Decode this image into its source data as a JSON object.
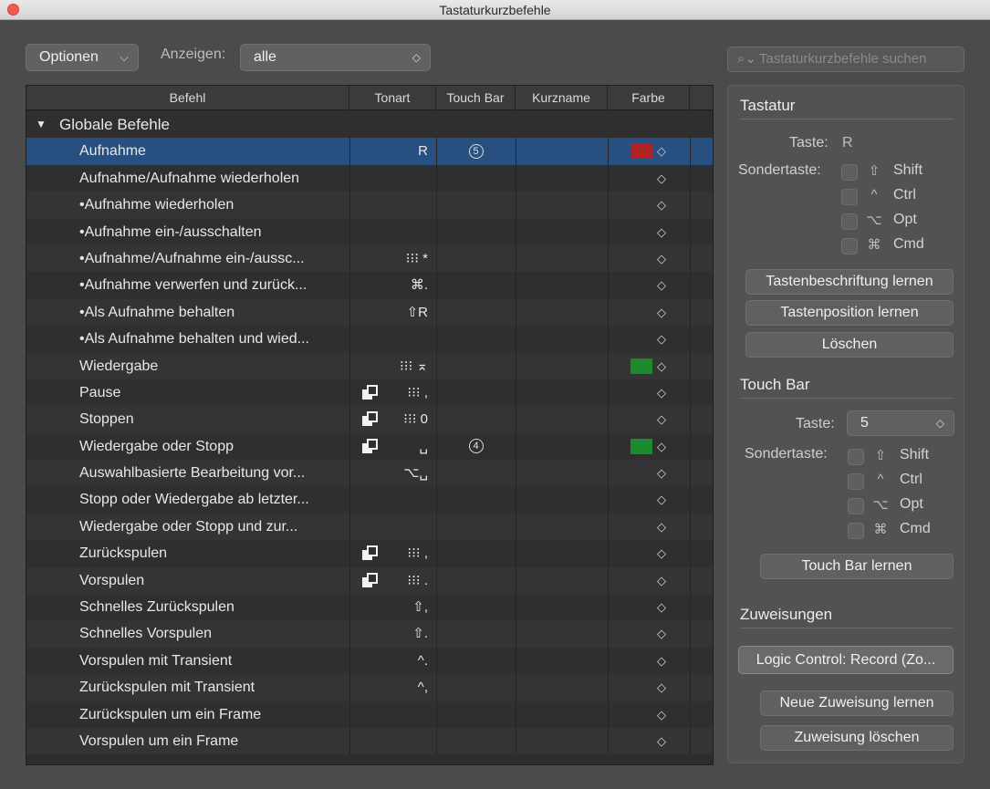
{
  "window": {
    "title": "Tastaturkurzbefehle"
  },
  "toolbar": {
    "options_label": "Optionen",
    "show_label": "Anzeigen:",
    "show_value": "alle",
    "search_placeholder": "Tastaturkurzbefehle suchen"
  },
  "table": {
    "columns": [
      "Befehl",
      "Tonart",
      "Touch Bar",
      "Kurzname",
      "Farbe"
    ],
    "group": "Globale Befehle",
    "rows": [
      {
        "name": "Aufnahme",
        "key": "R",
        "touchbar": "5",
        "color": "#b22222",
        "selected": true,
        "dup": false
      },
      {
        "name": "Aufnahme/Aufnahme wiederholen",
        "key": "",
        "touchbar": "",
        "color": "",
        "dup": false
      },
      {
        "name": "•Aufnahme wiederholen",
        "key": "",
        "touchbar": "",
        "color": "",
        "dup": false
      },
      {
        "name": "•Aufnahme ein-/ausschalten",
        "key": "",
        "touchbar": "",
        "color": "",
        "dup": false
      },
      {
        "name": "•Aufnahme/Aufnahme ein-/aussc...",
        "key": "⁝⁝⁝ *",
        "touchbar": "",
        "color": "",
        "dup": false
      },
      {
        "name": "•Aufnahme verwerfen und zurück...",
        "key": "⌘.",
        "touchbar": "",
        "color": "",
        "dup": false
      },
      {
        "name": "•Als Aufnahme behalten",
        "key": "⇧R",
        "touchbar": "",
        "color": "",
        "dup": false
      },
      {
        "name": "•Als Aufnahme behalten und wied...",
        "key": "",
        "touchbar": "",
        "color": "",
        "dup": false
      },
      {
        "name": "Wiedergabe",
        "key": "⁝⁝⁝ ⌅",
        "touchbar": "",
        "color": "#1e8a2e",
        "dup": false
      },
      {
        "name": "Pause",
        "key": "⁝⁝⁝ ,",
        "touchbar": "",
        "color": "",
        "dup": true
      },
      {
        "name": "Stoppen",
        "key": "⁝⁝⁝ 0",
        "touchbar": "",
        "color": "",
        "dup": true
      },
      {
        "name": "Wiedergabe oder Stopp",
        "key": "␣",
        "touchbar": "4",
        "color": "#1e8a2e",
        "dup": true
      },
      {
        "name": "Auswahlbasierte Bearbeitung vor...",
        "key": "⌥␣",
        "touchbar": "",
        "color": "",
        "dup": false
      },
      {
        "name": "Stopp oder Wiedergabe ab letzter...",
        "key": "",
        "touchbar": "",
        "color": "",
        "dup": false
      },
      {
        "name": "Wiedergabe oder Stopp und zur...",
        "key": "",
        "touchbar": "",
        "color": "",
        "dup": false
      },
      {
        "name": "Zurückspulen",
        "key": "⁝⁝⁝ ,",
        "touchbar": "",
        "color": "",
        "dup": true
      },
      {
        "name": "Vorspulen",
        "key": "⁝⁝⁝ .",
        "touchbar": "",
        "color": "",
        "dup": true
      },
      {
        "name": "Schnelles Zurückspulen",
        "key": "⇧,",
        "touchbar": "",
        "color": "",
        "dup": false
      },
      {
        "name": "Schnelles Vorspulen",
        "key": "⇧.",
        "touchbar": "",
        "color": "",
        "dup": false
      },
      {
        "name": "Vorspulen mit Transient",
        "key": "^.",
        "touchbar": "",
        "color": "",
        "dup": false
      },
      {
        "name": "Zurückspulen mit Transient",
        "key": "^,",
        "touchbar": "",
        "color": "",
        "dup": false
      },
      {
        "name": "Zurückspulen um ein Frame",
        "key": "",
        "touchbar": "",
        "color": "",
        "dup": false
      },
      {
        "name": "Vorspulen um ein Frame",
        "key": "",
        "touchbar": "",
        "color": "",
        "dup": false
      }
    ]
  },
  "panel": {
    "keyboard": {
      "title": "Tastatur",
      "key_label": "Taste:",
      "key_value": "R",
      "modifier_label": "Sondertaste:",
      "modifiers": [
        {
          "symbol": "⇧",
          "name": "Shift"
        },
        {
          "symbol": "^",
          "name": "Ctrl"
        },
        {
          "symbol": "⌥",
          "name": "Opt"
        },
        {
          "symbol": "⌘",
          "name": "Cmd"
        }
      ],
      "learn_label_button": "Tastenbeschriftung lernen",
      "learn_position_button": "Tastenposition lernen",
      "delete_button": "Löschen"
    },
    "touchbar": {
      "title": "Touch Bar",
      "key_label": "Taste:",
      "key_value": "5",
      "modifier_label": "Sondertaste:",
      "modifiers": [
        {
          "symbol": "⇧",
          "name": "Shift"
        },
        {
          "symbol": "^",
          "name": "Ctrl"
        },
        {
          "symbol": "⌥",
          "name": "Opt"
        },
        {
          "symbol": "⌘",
          "name": "Cmd"
        }
      ],
      "learn_button": "Touch Bar lernen"
    },
    "assignments": {
      "title": "Zuweisungen",
      "assignment_value": "Logic Control: Record (Zo...",
      "new_button": "Neue Zuweisung lernen",
      "delete_button": "Zuweisung löschen"
    }
  }
}
